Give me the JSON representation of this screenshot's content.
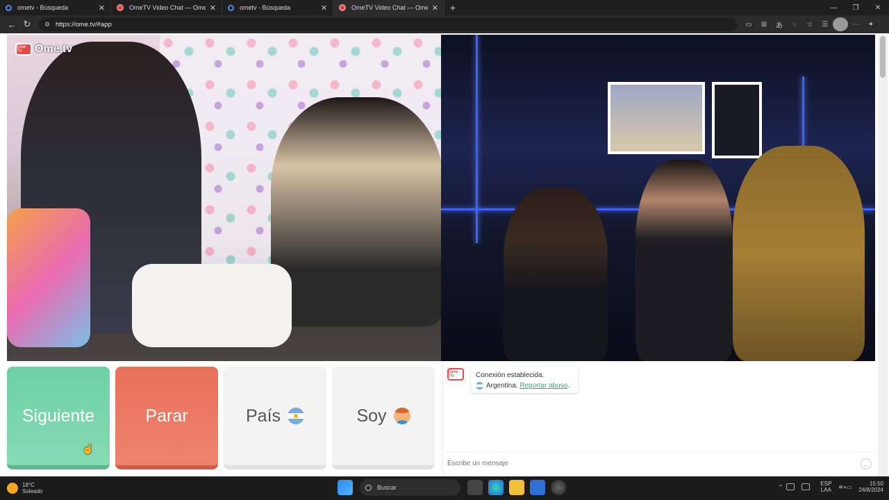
{
  "browser": {
    "tabs": [
      {
        "title": "ometv - Búsqueda",
        "type": "search",
        "active": false
      },
      {
        "title": "OmeTV Video Chat — Omegle",
        "type": "ome",
        "active": false
      },
      {
        "title": "ometv - Búsqueda",
        "type": "search",
        "active": false
      },
      {
        "title": "OmeTV Video Chat — Omegle",
        "type": "ome",
        "active": true
      }
    ],
    "url": "https://ome.tv/#app"
  },
  "video": {
    "logo_text": "Ome.tv",
    "logo_badge": "Ome TV"
  },
  "buttons": {
    "next": "Siguiente",
    "stop": "Parar",
    "country": "País",
    "gender": "Soy"
  },
  "chat": {
    "badge": "Ome TV",
    "status": "Conexión establecida.",
    "country": "Argentina.",
    "report": "Reportar abuso",
    "report_suffix": ".",
    "placeholder": "Escribe un mensaje"
  },
  "taskbar": {
    "weather_temp": "18°C",
    "weather_desc": "Soleado",
    "search": "Buscar",
    "lang_top": "ESP",
    "lang_bottom": "LAA",
    "time": "15:50",
    "date": "24/8/2024"
  },
  "colors": {
    "next": "#6fd0a4",
    "stop": "#e8715a",
    "neutral": "#f3f3f3",
    "link": "#3aa675"
  }
}
